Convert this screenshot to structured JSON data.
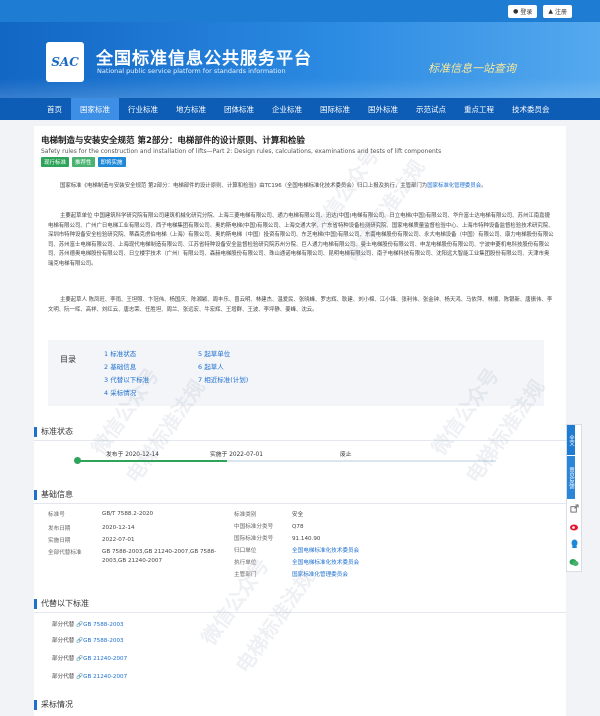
{
  "topbar": {
    "login": "登录",
    "register": "注册"
  },
  "header": {
    "logo_text": "SAC",
    "title": "全国标准信息公共服务平台",
    "subtitle": "National public service platform  for standards information",
    "slogan": "标准信息一站查询"
  },
  "nav": {
    "items": [
      "首页",
      "国家标准",
      "行业标准",
      "地方标准",
      "团体标准",
      "企业标准",
      "国际标准",
      "国外标准",
      "示范试点",
      "重点工程",
      "技术委员会"
    ],
    "active_index": 1
  },
  "standard": {
    "title": "电梯制造与安装安全规范 第2部分：电梯部件的设计原则、计算和检验",
    "en_title": "Safety rules for the construction and installation of lifts—Part 2: Design rules, calculations, examinations and tests of lift components",
    "tags": [
      {
        "label": "现行标准",
        "color": "#2ea35a"
      },
      {
        "label": "推荐性",
        "color": "#49b270"
      },
      {
        "label": "即将实施",
        "color": "#1e88d8"
      }
    ]
  },
  "description": {
    "p1_prefix": "国家标准《电梯制造与安装安全规范 第2部分：电梯部件的设计原则、计算和检验》由TC196（全国电梯标准化技术委员会）归口上报及执行，主管部门为",
    "p1_link": "国家标准化管理委员会",
    "p1_suffix": "。",
    "p2": "主要起草单位 中国建筑科学研究院有限公司建筑机械化研究分院、上海三菱电梯有限公司、通力电梯有限公司、迅达(中国)电梯有限公司、日立电梯(中国)有限公司、华升富士达电梯有限公司、苏州江南嘉捷电梯有限公司、广州广日电梯工业有限公司、西子电梯集团有限公司、奥的斯电梯(中国)有限公司、上海交通大学、广东省特种设备检测研究院、国家电梯质量监督检验中心、上海市特种设备监督检验技术研究院、深圳市特种设备安全检验研究院、蒂森克虏伯电梯（上海）有限公司、奥的斯电梯（中国）投资有限公司、东芝电梯(中国)有限公司、东南电梯股份有限公司、永大电梯设备（中国）有限公司、康力电梯股份有限公司、苏州富士电梯有限公司、上海现代电梯制造有限公司、江苏省特种设备安全监督检验研究院苏州分院、巨人通力电梯有限公司、曼士电梯股份有限公司、申龙电梯股份有限公司、宁波申菱机电科技股份有限公司、苏州德奥电梯股份有限公司、日立楼宇技术（广州）有限公司、森赫电梯股份有限公司、珠山通诺电梯有限公司、昆明电梯有限公司、南子电梯科技有限公司、沈阳远大智能工业集团股份有限公司、天津市奥瑞克电梯有限公司。",
    "p3": "主要起草人 陈凤旺、李雨、王坦照、卞冠伟、杨国庆、陈湘颖、周丰乐、曾云明、林建杰、温爱民、张晓峰、罗志辉、耿建、刘小棉、江小锋、张利伟、张金钟、杨天鸿、马依萍、林顺、陈银新、唐振伟、李文明、阮一晖、高祥、刘红云、唐志荣、任胜坦、周兰、张远宏、牛宏辉、王增群、王波、李坪静、姜峰、沈云。"
  },
  "toc": {
    "label": "目录",
    "items": [
      "1 标准状态",
      "2 基础信息",
      "3 代替以下标准",
      "4 采标情况",
      "5 起草单位",
      "6 起草人",
      "7 相近标准(计划)"
    ]
  },
  "status": {
    "heading": "标准状态",
    "publish": "发布于 2020-12-14",
    "implement": "实施于 2022-07-01",
    "abolish": "废止"
  },
  "basic": {
    "heading": "基础信息",
    "left": [
      {
        "k": "标准号",
        "v": "GB/T 7588.2-2020"
      },
      {
        "k": "发布日期",
        "v": "2020-12-14"
      },
      {
        "k": "实施日期",
        "v": "2022-07-01"
      },
      {
        "k": "全部代替标准",
        "v": "GB 7588-2003,GB 21240-2007,GB 7588-2003,GB 21240-2007"
      }
    ],
    "right": [
      {
        "k": "标准类别",
        "v": "安全"
      },
      {
        "k": "中国标准分类号",
        "v": "Q78"
      },
      {
        "k": "国际标准分类号",
        "v": "91.140.90"
      },
      {
        "k": "归口单位",
        "v": "全国电梯标准化技术委员会"
      },
      {
        "k": "执行单位",
        "v": "全国电梯标准化技术委员会"
      },
      {
        "k": "主管部门",
        "v": "国家标准化管理委员会"
      }
    ]
  },
  "replace": {
    "heading": "代替以下标准",
    "items": [
      {
        "k": "部分代替",
        "v": "GB 7588-2003"
      },
      {
        "k": "部分代替",
        "v": "GB 7588-2003"
      },
      {
        "k": "部分代替",
        "v": "GB 21240-2007"
      },
      {
        "k": "部分代替",
        "v": "GB 21240-2007"
      }
    ]
  },
  "adopt": {
    "heading": "采标情况"
  },
  "sidebar": {
    "items": [
      "全文",
      "意见反馈"
    ]
  },
  "watermark": {
    "line1": "微信公众号",
    "line2": "电梯标准法规"
  }
}
